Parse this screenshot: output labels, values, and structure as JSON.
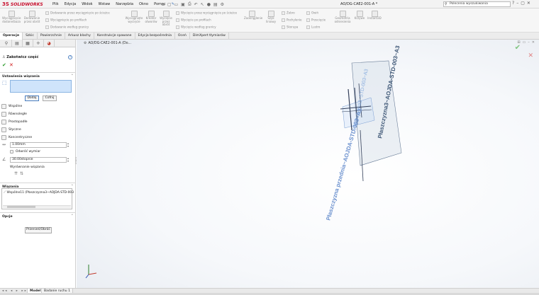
{
  "app": {
    "logo_ds": "3S",
    "logo_name": "SOLIDWORKS",
    "doc_title": "AO/DG-CAE2-001-A *"
  },
  "menu": [
    "Plik",
    "Edycja",
    "Widok",
    "Wstaw",
    "Narzędzia",
    "Okno",
    "Pomoc"
  ],
  "search": {
    "placeholder": "Polecenia wyszukiwania"
  },
  "toolbar": {
    "col1_label": "Wyciągnięcie dodane/baza",
    "col2_label": "Dodawanie przez obrót",
    "row1": "Dodawanie przez wyciągnięcie po ścieżce",
    "row2": "Wyciągnięcie po profilach",
    "row3": "Dodawanie według granicy",
    "col3_label": "Wyciągnięte wycięcie",
    "col4_label": "Kreator otworów",
    "col5_label": "Wycięcie przez obrót",
    "row4": "Wycięcie przez wyciągnięcie po ścieżce",
    "row5": "Wycięcie po profilach",
    "row6": "Wycięcie według granicy",
    "col6_label": "Zaokrąglenie",
    "col7_label": "Szyk liniowy",
    "r7": "Żebro",
    "r8": "Pochylenie",
    "r9": "Skorupa",
    "r10": "Owiń",
    "r11": "Przecięcie",
    "r12": "Lustro",
    "col8_label": "Geometria odniesienia",
    "col9_label": "Krzywe",
    "col10_label": "Instant3D"
  },
  "tabs": [
    "Operacje",
    "Szkic",
    "Powierzchnie",
    "Arkusz blachy",
    "Konstrukcje spawane",
    "Edycja bezpośrednia",
    "Oceń",
    "DimXpert tłymiarów"
  ],
  "panel": {
    "title": "Zakotwicz część",
    "help": "?",
    "settings_title": "Ustawienia wiązania",
    "add_btn": "Dodaj",
    "remove_btn": "Cofnij",
    "mate_types": [
      "Wspólne",
      "Równoległe",
      "Prostopadłe",
      "Styczne",
      "Koncentryczne"
    ],
    "distance_value": "1.00mm",
    "flip_label": "Odwróć wymiar",
    "angle_value": "30.00stopnie",
    "alignment_label": "Wyrównanie wiązania",
    "mates_title": "Wiązania",
    "mate_item": "Wspólne11 (Płaszczyzna3~AOJDA-STD-003",
    "options_title": "Opcje",
    "move_btn": "Przenieś/Obróć"
  },
  "viewport": {
    "breadcrumb": "AO/DG-CAE2-001-A (Do...",
    "plane_label_top": "Płaszczyzna3~AOJDA-STD-003~A3",
    "plane_label_small": "Płaszczyzna3~STD-003~A3",
    "plane_label_front": "Płaszczyzna przednia~AOJDA-STD-003~A3"
  },
  "bottom_tabs": [
    "Model",
    "Badanie ruchu 1"
  ]
}
